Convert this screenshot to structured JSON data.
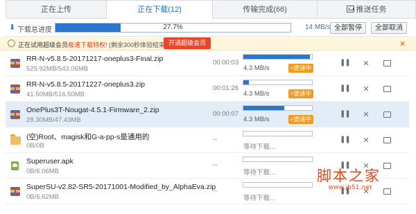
{
  "tabs": [
    {
      "label": "正在上传",
      "active": false
    },
    {
      "label": "正在下载(12)",
      "active": true
    },
    {
      "label": "传输完成(66)",
      "active": false
    },
    {
      "label": "推送任务",
      "active": false,
      "icon": "push-task-icon"
    }
  ],
  "toolbar": {
    "label": "下载总进度",
    "progress_text": "27.7%",
    "progress": 0.277,
    "speed": "14 MB/s",
    "pause_all": "全部暂停",
    "cancel_all": "全部取消"
  },
  "vip": {
    "text_prefix": "正在试用超级会员",
    "text_highlight": "极速下载特权!",
    "text_suffix": "(剩余300秒体验结束)",
    "button": "开通超级会员",
    "close": "×"
  },
  "downloads": [
    {
      "name": "RR-N-v5.8.5-20171217-oneplus3-Final.zip",
      "size": "525.92MB/543.06MB",
      "time": "00:00:03",
      "progress": 0.97,
      "speed": "4.3 MB/s",
      "badge": "提速中",
      "icon": "zip-file-icon"
    },
    {
      "name": "RR-N-v5.8.5-20171227-oneplus3.zip",
      "size": "41.50MB/516.50MB",
      "time": "00:01:26",
      "progress": 0.08,
      "speed": "4.3 MB/s",
      "badge": "提速中",
      "icon": "zip-file-icon"
    },
    {
      "name": "OnePlus3T-Nougat-4.5.1-Firmware_2.zip",
      "size": "28.30MB/47.43MB",
      "time": "00:00:07",
      "progress": 0.6,
      "speed": "4.3 MB/s",
      "badge": "提速中",
      "icon": "zip-file-icon"
    },
    {
      "name": "(空)Root、magisk和G-a-pp-s是通用的",
      "size": "0B/0B",
      "time": "--",
      "progress": 0,
      "status": "等待下载...",
      "icon": "folder-icon"
    },
    {
      "name": "Superuser.apk",
      "size": "0B/6.06MB",
      "time": "--",
      "progress": 0,
      "status": "等待下载...",
      "icon": "apk-file-icon"
    },
    {
      "name": "SuperSU-v2.82-SR5-20171001-Modified_by_AlphaEva.zip",
      "size": "0B/6.62MB",
      "time": "--",
      "progress": 0,
      "status": "等待下载...",
      "icon": "zip-file-icon"
    }
  ],
  "watermark": {
    "title": "脚本之家",
    "url": "www.jb51.net"
  }
}
